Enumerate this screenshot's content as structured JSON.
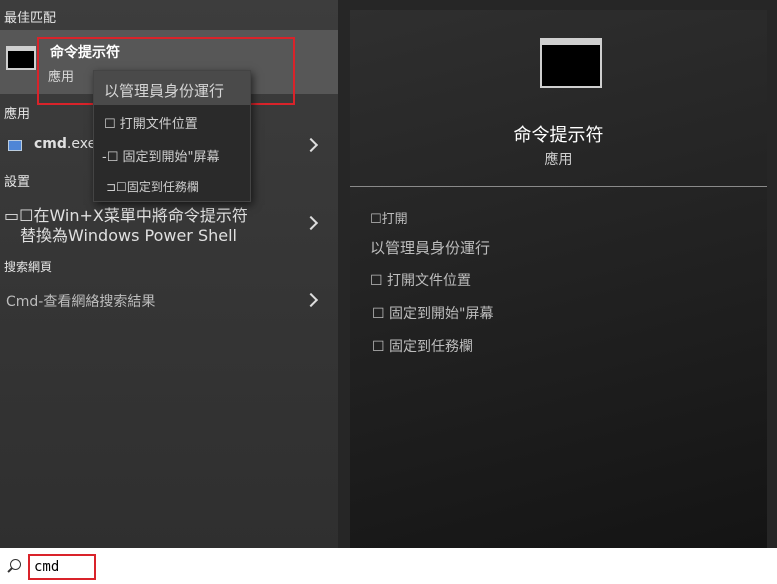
{
  "sections": {
    "best_match": "最佳匹配",
    "apps": "應用",
    "settings": "設置",
    "web_search": "搜索網頁"
  },
  "best_match": {
    "title": "命令提示符",
    "type": "應用"
  },
  "context_menu": {
    "items": [
      "以管理員身份運行",
      "☐ 打開文件位置",
      "-☐ 固定到開始\"屏幕",
      "⊐☐固定到任務欄"
    ]
  },
  "apps_list": {
    "cmd_bold": "cmd",
    "cmd_rest": ".exe"
  },
  "settings_item": {
    "line1": "▭☐在Win+X菜單中將命令提示符",
    "line2": "替換為Windows Power Shell"
  },
  "web_item": {
    "text": "Cmd-查看網絡搜索結果"
  },
  "detail": {
    "title": "命令提示符",
    "type": "應用",
    "actions": [
      "☐打開",
      "以管理員身份運行",
      "☐ 打開文件位置",
      "☐ 固定到開始\"屏幕",
      "☐ 固定到任務欄"
    ]
  },
  "search": {
    "value": "cmd"
  },
  "colors": {
    "highlight_red": "#d9232a",
    "selected_bg": "#575757"
  }
}
